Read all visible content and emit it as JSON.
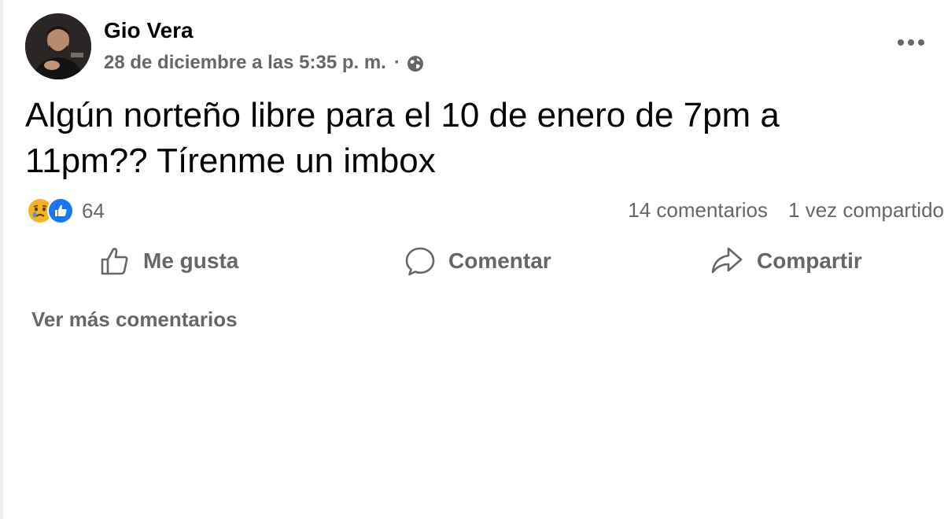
{
  "post": {
    "author": "Gio Vera",
    "timestamp": "28 de diciembre a las 5:35 p. m.",
    "separator": "·",
    "audience_icon": "globe-icon",
    "more_icon": "more-horizontal-icon",
    "text": "Algún norteño libre para el 10 de enero de 7pm a 11pm?? Tírenme un imbox"
  },
  "reactions": {
    "icons": [
      "sad-reaction-icon",
      "like-reaction-icon"
    ],
    "count": "64"
  },
  "stats": {
    "comments": "14 comentarios",
    "shares": "1 vez compartido"
  },
  "actions": {
    "like_label": "Me gusta",
    "like_icon": "thumbs-up-icon",
    "comment_label": "Comentar",
    "comment_icon": "comment-bubble-icon",
    "share_label": "Compartir",
    "share_icon": "share-arrow-icon"
  },
  "comments": {
    "view_more_label": "Ver más comentarios"
  },
  "colors": {
    "primary_text": "#050505",
    "secondary_text": "#65676b",
    "like_blue": "#1877f2",
    "sad_yellow": "#f7b125"
  }
}
